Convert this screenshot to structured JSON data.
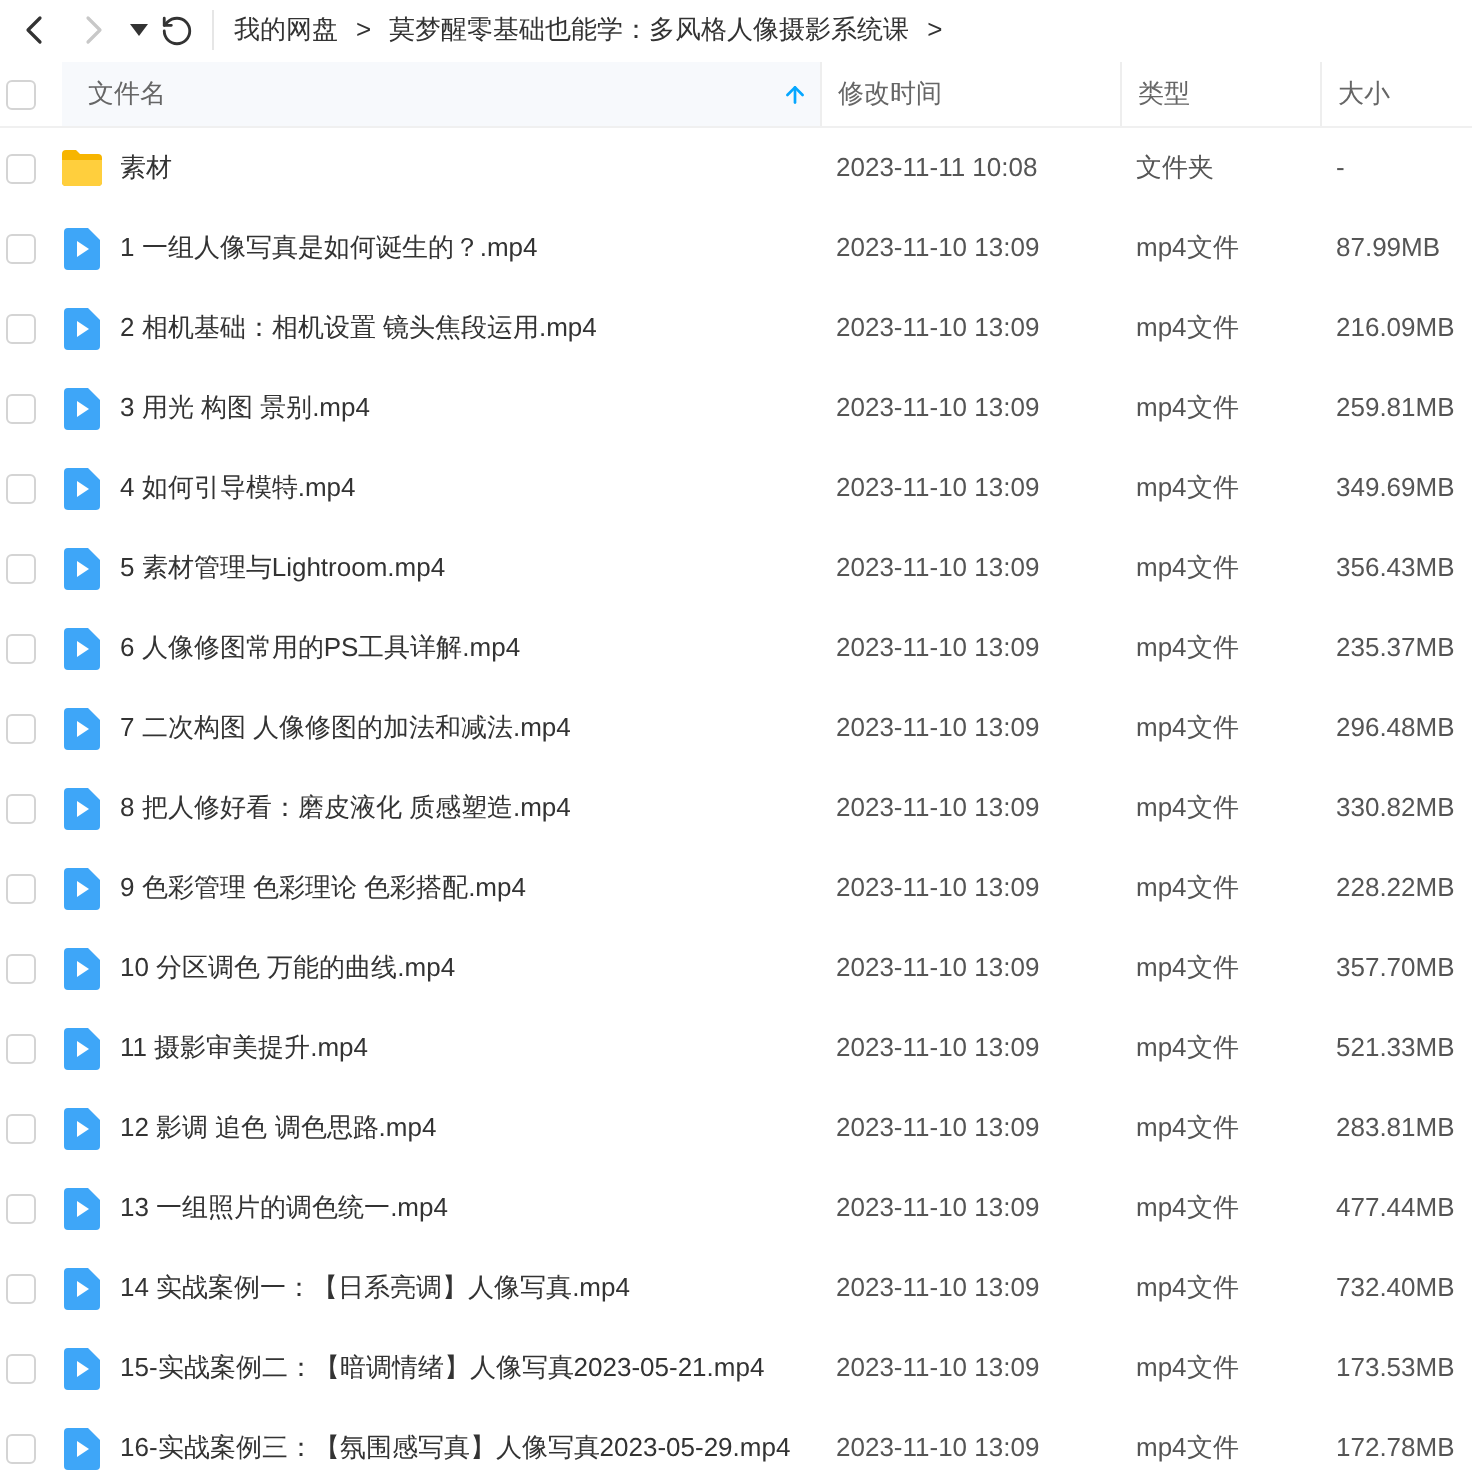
{
  "nav_buttons": [
    {
      "kind": "back",
      "disabled": false
    },
    {
      "kind": "forward",
      "disabled": true
    },
    {
      "kind": "history",
      "disabled": false
    },
    {
      "kind": "refresh",
      "disabled": false
    }
  ],
  "breadcrumb": {
    "separator": ">",
    "items": [
      "我的网盘",
      "莫梦醒零基础也能学：多风格人像摄影系统课"
    ]
  },
  "table": {
    "select_all_checked": false,
    "columns": [
      {
        "label": "文件名",
        "sorted": true
      },
      {
        "label": "修改时间",
        "sorted": false
      },
      {
        "label": "类型",
        "sorted": false
      },
      {
        "label": "大小",
        "sorted": false
      }
    ],
    "rows": [
      {
        "kind": "folder",
        "checked": false,
        "name": "素材",
        "modified": "2023-11-11 10:08",
        "type": "文件夹",
        "size": "-"
      },
      {
        "kind": "video",
        "checked": false,
        "name": "1 一组人像写真是如何诞生的？.mp4",
        "modified": "2023-11-10 13:09",
        "type": "mp4文件",
        "size": "87.99MB"
      },
      {
        "kind": "video",
        "checked": false,
        "name": "2 相机基础：相机设置 镜头焦段运用.mp4",
        "modified": "2023-11-10 13:09",
        "type": "mp4文件",
        "size": "216.09MB"
      },
      {
        "kind": "video",
        "checked": false,
        "name": "3 用光 构图 景别.mp4",
        "modified": "2023-11-10 13:09",
        "type": "mp4文件",
        "size": "259.81MB"
      },
      {
        "kind": "video",
        "checked": false,
        "name": "4 如何引导模特.mp4",
        "modified": "2023-11-10 13:09",
        "type": "mp4文件",
        "size": "349.69MB"
      },
      {
        "kind": "video",
        "checked": false,
        "name": "5 素材管理与Lightroom.mp4",
        "modified": "2023-11-10 13:09",
        "type": "mp4文件",
        "size": "356.43MB"
      },
      {
        "kind": "video",
        "checked": false,
        "name": "6 人像修图常用的PS工具详解.mp4",
        "modified": "2023-11-10 13:09",
        "type": "mp4文件",
        "size": "235.37MB"
      },
      {
        "kind": "video",
        "checked": false,
        "name": "7 二次构图 人像修图的加法和减法.mp4",
        "modified": "2023-11-10 13:09",
        "type": "mp4文件",
        "size": "296.48MB"
      },
      {
        "kind": "video",
        "checked": false,
        "name": "8 把人修好看：磨皮液化 质感塑造.mp4",
        "modified": "2023-11-10 13:09",
        "type": "mp4文件",
        "size": "330.82MB"
      },
      {
        "kind": "video",
        "checked": false,
        "name": "9 色彩管理 色彩理论 色彩搭配.mp4",
        "modified": "2023-11-10 13:09",
        "type": "mp4文件",
        "size": "228.22MB"
      },
      {
        "kind": "video",
        "checked": false,
        "name": "10 分区调色 万能的曲线.mp4",
        "modified": "2023-11-10 13:09",
        "type": "mp4文件",
        "size": "357.70MB"
      },
      {
        "kind": "video",
        "checked": false,
        "name": "11 摄影审美提升.mp4",
        "modified": "2023-11-10 13:09",
        "type": "mp4文件",
        "size": "521.33MB"
      },
      {
        "kind": "video",
        "checked": false,
        "name": "12 影调 追色 调色思路.mp4",
        "modified": "2023-11-10 13:09",
        "type": "mp4文件",
        "size": "283.81MB"
      },
      {
        "kind": "video",
        "checked": false,
        "name": "13 一组照片的调色统一.mp4",
        "modified": "2023-11-10 13:09",
        "type": "mp4文件",
        "size": "477.44MB"
      },
      {
        "kind": "video",
        "checked": false,
        "name": "14 实战案例一：【日系亮调】人像写真.mp4",
        "modified": "2023-11-10 13:09",
        "type": "mp4文件",
        "size": "732.40MB"
      },
      {
        "kind": "video",
        "checked": false,
        "name": "15-实战案例二：【暗调情绪】人像写真2023-05-21.mp4",
        "modified": "2023-11-10 13:09",
        "type": "mp4文件",
        "size": "173.53MB"
      },
      {
        "kind": "video",
        "checked": false,
        "name": "16-实战案例三：【氛围感写真】人像写真2023-05-29.mp4",
        "modified": "2023-11-10 13:09",
        "type": "mp4文件",
        "size": "172.78MB"
      }
    ]
  }
}
